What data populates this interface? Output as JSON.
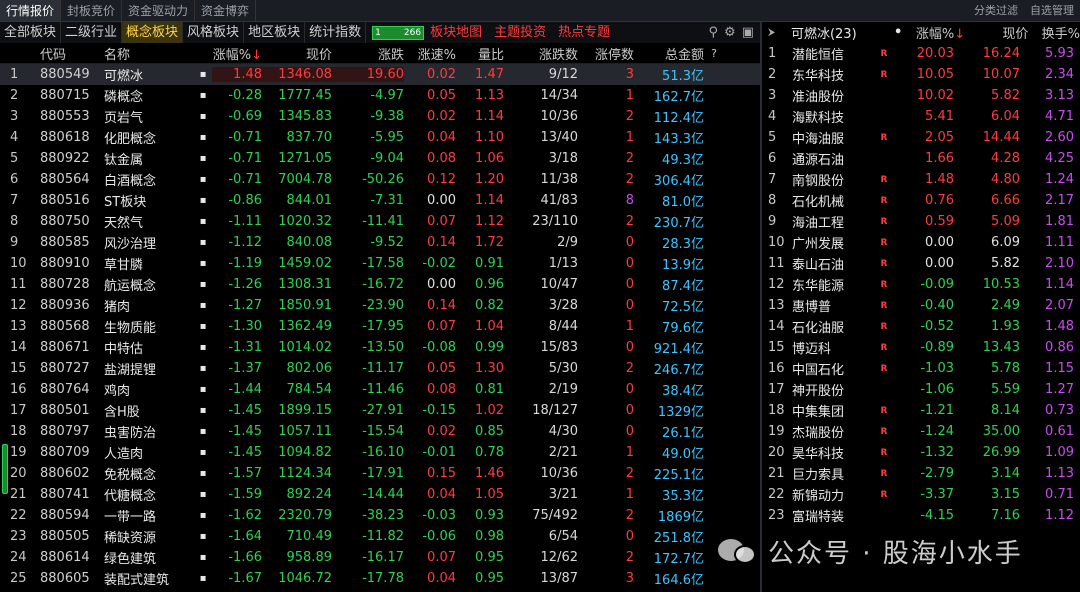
{
  "top_tabs": [
    "行情报价",
    "封板竞价",
    "资金驱动力",
    "资金博弈"
  ],
  "top_right": [
    "分类过滤",
    "自选管理"
  ],
  "categories": [
    "全部板块",
    "二级行业",
    "概念板块",
    "风格板块",
    "地区板块",
    "统计指数"
  ],
  "indicator": {
    "left": "1",
    "right": "266"
  },
  "red_links": [
    "板块地图",
    "主题投资",
    "热点专题"
  ],
  "icons": [
    "search-icon",
    "gear-icon",
    "expand-icon"
  ],
  "table": {
    "headers": {
      "code": "代码",
      "name": "名称",
      "pct": "涨幅%",
      "price": "现价",
      "chg": "涨跌",
      "speed": "涨速%",
      "ratio": "量比",
      "updn": "涨跌数",
      "limit": "涨停数",
      "amount": "总金额",
      "help": "?"
    },
    "sort_arrow": "↓",
    "rows": [
      {
        "idx": "1",
        "code": "880549",
        "name": "可燃冰",
        "pct": "1.48",
        "price": "1346.08",
        "chg": "19.60",
        "speed": "0.02",
        "ratio": "1.47",
        "updn": "9/12",
        "limit": "3",
        "amount": "51.3亿"
      },
      {
        "idx": "2",
        "code": "880715",
        "name": "磷概念",
        "pct": "-0.28",
        "price": "1777.45",
        "chg": "-4.97",
        "speed": "0.05",
        "ratio": "1.13",
        "updn": "14/34",
        "limit": "1",
        "amount": "162.7亿"
      },
      {
        "idx": "3",
        "code": "880553",
        "name": "页岩气",
        "pct": "-0.69",
        "price": "1345.83",
        "chg": "-9.38",
        "speed": "0.02",
        "ratio": "1.14",
        "updn": "10/36",
        "limit": "2",
        "amount": "112.4亿"
      },
      {
        "idx": "4",
        "code": "880618",
        "name": "化肥概念",
        "pct": "-0.71",
        "price": "837.70",
        "chg": "-5.95",
        "speed": "0.04",
        "ratio": "1.10",
        "updn": "13/40",
        "limit": "1",
        "amount": "143.3亿"
      },
      {
        "idx": "5",
        "code": "880922",
        "name": "钛金属",
        "pct": "-0.71",
        "price": "1271.05",
        "chg": "-9.04",
        "speed": "0.08",
        "ratio": "1.06",
        "updn": "3/18",
        "limit": "2",
        "amount": "49.3亿"
      },
      {
        "idx": "6",
        "code": "880564",
        "name": "白酒概念",
        "pct": "-0.71",
        "price": "7004.78",
        "chg": "-50.26",
        "speed": "0.12",
        "ratio": "1.20",
        "updn": "11/38",
        "limit": "2",
        "amount": "306.4亿"
      },
      {
        "idx": "7",
        "code": "880516",
        "name": "ST板块",
        "pct": "-0.86",
        "price": "844.01",
        "chg": "-7.31",
        "speed": "0.00",
        "ratio": "1.14",
        "updn": "41/83",
        "limit": "8",
        "amount": "81.0亿"
      },
      {
        "idx": "8",
        "code": "880750",
        "name": "天然气",
        "pct": "-1.11",
        "price": "1020.32",
        "chg": "-11.41",
        "speed": "0.07",
        "ratio": "1.12",
        "updn": "23/110",
        "limit": "2",
        "amount": "230.7亿"
      },
      {
        "idx": "9",
        "code": "880585",
        "name": "风沙治理",
        "pct": "-1.12",
        "price": "840.08",
        "chg": "-9.52",
        "speed": "0.14",
        "ratio": "1.72",
        "updn": "2/9",
        "limit": "0",
        "amount": "28.3亿"
      },
      {
        "idx": "10",
        "code": "880910",
        "name": "草甘膦",
        "pct": "-1.19",
        "price": "1459.02",
        "chg": "-17.58",
        "speed": "-0.02",
        "ratio": "0.91",
        "updn": "1/13",
        "limit": "0",
        "amount": "13.9亿"
      },
      {
        "idx": "11",
        "code": "880728",
        "name": "航运概念",
        "pct": "-1.26",
        "price": "1308.31",
        "chg": "-16.72",
        "speed": "0.00",
        "ratio": "0.96",
        "updn": "10/47",
        "limit": "0",
        "amount": "87.4亿"
      },
      {
        "idx": "12",
        "code": "880936",
        "name": "猪肉",
        "pct": "-1.27",
        "price": "1850.91",
        "chg": "-23.90",
        "speed": "0.14",
        "ratio": "0.82",
        "updn": "3/28",
        "limit": "0",
        "amount": "72.5亿"
      },
      {
        "idx": "13",
        "code": "880568",
        "name": "生物质能",
        "pct": "-1.30",
        "price": "1362.49",
        "chg": "-17.95",
        "speed": "0.07",
        "ratio": "1.04",
        "updn": "8/44",
        "limit": "1",
        "amount": "79.6亿"
      },
      {
        "idx": "14",
        "code": "880671",
        "name": "中特估",
        "pct": "-1.31",
        "price": "1014.02",
        "chg": "-13.50",
        "speed": "-0.08",
        "ratio": "0.99",
        "updn": "15/83",
        "limit": "0",
        "amount": "921.4亿"
      },
      {
        "idx": "15",
        "code": "880727",
        "name": "盐湖提锂",
        "pct": "-1.37",
        "price": "802.06",
        "chg": "-11.17",
        "speed": "0.05",
        "ratio": "1.30",
        "updn": "5/30",
        "limit": "2",
        "amount": "246.7亿"
      },
      {
        "idx": "16",
        "code": "880764",
        "name": "鸡肉",
        "pct": "-1.44",
        "price": "784.54",
        "chg": "-11.46",
        "speed": "0.08",
        "ratio": "0.81",
        "updn": "2/19",
        "limit": "0",
        "amount": "38.4亿"
      },
      {
        "idx": "17",
        "code": "880501",
        "name": "含H股",
        "pct": "-1.45",
        "price": "1899.15",
        "chg": "-27.91",
        "speed": "-0.15",
        "ratio": "1.02",
        "updn": "18/127",
        "limit": "0",
        "amount": "1329亿"
      },
      {
        "idx": "18",
        "code": "880797",
        "name": "虫害防治",
        "pct": "-1.45",
        "price": "1057.11",
        "chg": "-15.54",
        "speed": "0.02",
        "ratio": "0.85",
        "updn": "4/30",
        "limit": "0",
        "amount": "26.1亿"
      },
      {
        "idx": "19",
        "code": "880709",
        "name": "人造肉",
        "pct": "-1.45",
        "price": "1094.82",
        "chg": "-16.10",
        "speed": "-0.01",
        "ratio": "0.78",
        "updn": "2/21",
        "limit": "1",
        "amount": "49.0亿"
      },
      {
        "idx": "20",
        "code": "880602",
        "name": "免税概念",
        "pct": "-1.57",
        "price": "1124.34",
        "chg": "-17.91",
        "speed": "0.15",
        "ratio": "1.46",
        "updn": "10/36",
        "limit": "2",
        "amount": "225.1亿"
      },
      {
        "idx": "21",
        "code": "880741",
        "name": "代糖概念",
        "pct": "-1.59",
        "price": "892.24",
        "chg": "-14.44",
        "speed": "0.04",
        "ratio": "1.05",
        "updn": "3/21",
        "limit": "1",
        "amount": "35.3亿"
      },
      {
        "idx": "22",
        "code": "880594",
        "name": "一带一路",
        "pct": "-1.62",
        "price": "2320.79",
        "chg": "-38.23",
        "speed": "-0.03",
        "ratio": "0.93",
        "updn": "75/492",
        "limit": "2",
        "amount": "1869亿"
      },
      {
        "idx": "23",
        "code": "880505",
        "name": "稀缺资源",
        "pct": "-1.64",
        "price": "710.49",
        "chg": "-11.82",
        "speed": "-0.06",
        "ratio": "0.98",
        "updn": "6/54",
        "limit": "0",
        "amount": "251.8亿"
      },
      {
        "idx": "24",
        "code": "880614",
        "name": "绿色建筑",
        "pct": "-1.66",
        "price": "958.89",
        "chg": "-16.17",
        "speed": "0.07",
        "ratio": "0.95",
        "updn": "12/62",
        "limit": "2",
        "amount": "172.7亿"
      },
      {
        "idx": "25",
        "code": "880605",
        "name": "装配式建筑",
        "pct": "-1.67",
        "price": "1046.72",
        "chg": "-17.78",
        "speed": "0.04",
        "ratio": "0.95",
        "updn": "13/87",
        "limit": "3",
        "amount": "164.6亿"
      }
    ]
  },
  "side": {
    "header": {
      "icon": "pin-icon",
      "title": "可燃冰(23)",
      "dot": "•",
      "pct": "涨幅%",
      "arrow": "↓",
      "price": "现价",
      "turnover": "换手%"
    },
    "rows": [
      {
        "idx": "1",
        "name": "潜能恒信",
        "r": "R",
        "pct": "20.03",
        "price": "16.24",
        "tr": "5.93"
      },
      {
        "idx": "2",
        "name": "东华科技",
        "r": "R",
        "pct": "10.05",
        "price": "10.07",
        "tr": "2.34"
      },
      {
        "idx": "3",
        "name": "准油股份",
        "r": "",
        "pct": "10.02",
        "price": "5.82",
        "tr": "3.13"
      },
      {
        "idx": "4",
        "name": "海默科技",
        "r": "",
        "pct": "5.41",
        "price": "6.04",
        "tr": "4.71"
      },
      {
        "idx": "5",
        "name": "中海油服",
        "r": "R",
        "pct": "2.05",
        "price": "14.44",
        "tr": "2.60"
      },
      {
        "idx": "6",
        "name": "通源石油",
        "r": "",
        "pct": "1.66",
        "price": "4.28",
        "tr": "4.25"
      },
      {
        "idx": "7",
        "name": "南钢股份",
        "r": "R",
        "pct": "1.48",
        "price": "4.80",
        "tr": "1.24"
      },
      {
        "idx": "8",
        "name": "石化机械",
        "r": "R",
        "pct": "0.76",
        "price": "6.66",
        "tr": "2.17"
      },
      {
        "idx": "9",
        "name": "海油工程",
        "r": "R",
        "pct": "0.59",
        "price": "5.09",
        "tr": "1.81"
      },
      {
        "idx": "10",
        "name": "广州发展",
        "r": "R",
        "pct": "0.00",
        "price": "6.09",
        "tr": "1.11"
      },
      {
        "idx": "11",
        "name": "泰山石油",
        "r": "R",
        "pct": "0.00",
        "price": "5.82",
        "tr": "2.10"
      },
      {
        "idx": "12",
        "name": "东华能源",
        "r": "R",
        "pct": "-0.09",
        "price": "10.53",
        "tr": "1.14"
      },
      {
        "idx": "13",
        "name": "惠博普",
        "r": "R",
        "pct": "-0.40",
        "price": "2.49",
        "tr": "2.07"
      },
      {
        "idx": "14",
        "name": "石化油服",
        "r": "R",
        "pct": "-0.52",
        "price": "1.93",
        "tr": "1.48"
      },
      {
        "idx": "15",
        "name": "博迈科",
        "r": "R",
        "pct": "-0.89",
        "price": "13.43",
        "tr": "0.86"
      },
      {
        "idx": "16",
        "name": "中国石化",
        "r": "R",
        "pct": "-1.03",
        "price": "5.78",
        "tr": "1.15"
      },
      {
        "idx": "17",
        "name": "神开股份",
        "r": "",
        "pct": "-1.06",
        "price": "5.59",
        "tr": "1.27"
      },
      {
        "idx": "18",
        "name": "中集集团",
        "r": "R",
        "pct": "-1.21",
        "price": "8.14",
        "tr": "0.73"
      },
      {
        "idx": "19",
        "name": "杰瑞股份",
        "r": "R",
        "pct": "-1.24",
        "price": "35.00",
        "tr": "0.61"
      },
      {
        "idx": "20",
        "name": "昊华科技",
        "r": "R",
        "pct": "-1.32",
        "price": "26.99",
        "tr": "1.09"
      },
      {
        "idx": "21",
        "name": "巨力索具",
        "r": "R",
        "pct": "-2.79",
        "price": "3.14",
        "tr": "1.13"
      },
      {
        "idx": "22",
        "name": "新锦动力",
        "r": "R",
        "pct": "-3.37",
        "price": "3.15",
        "tr": "0.71"
      },
      {
        "idx": "23",
        "name": "富瑞特装",
        "r": "",
        "pct": "-4.15",
        "price": "7.16",
        "tr": "1.12"
      }
    ]
  },
  "watermark": {
    "text": "公众号 · 股海小水手",
    "icon": "wechat-icon"
  },
  "colors": {
    "up": "#ff3b3b",
    "down": "#2fd150",
    "flat": "#e0e0e0",
    "amount": "#3ec4ff",
    "turnover": "#c94cf0",
    "active_tab": "#ffd34d"
  }
}
